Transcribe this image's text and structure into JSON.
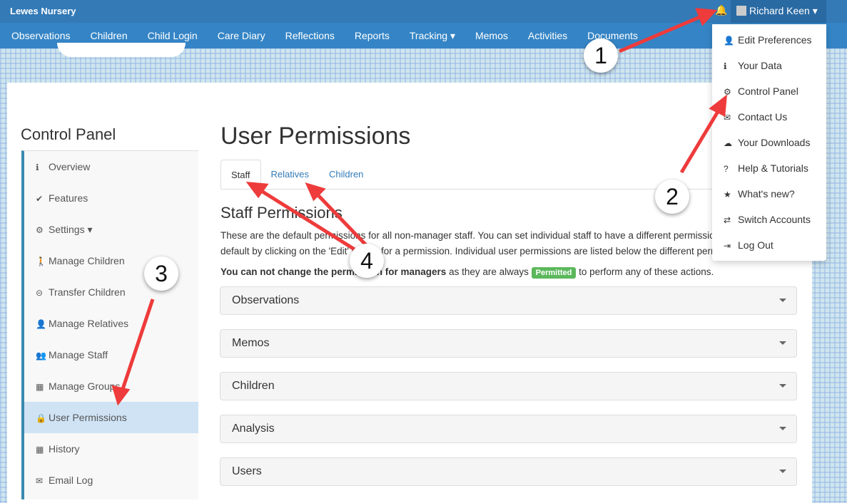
{
  "header": {
    "brand": "Lewes Nursery",
    "user": "Richard Keen"
  },
  "nav": [
    "Observations",
    "Children",
    "Child Login",
    "Care Diary",
    "Reflections",
    "Reports",
    "Tracking ▾",
    "Memos",
    "Activities",
    "Documents"
  ],
  "user_menu": [
    {
      "icon": "user-icon",
      "glyph": "👤",
      "label": "Edit Preferences"
    },
    {
      "icon": "info-icon",
      "glyph": "ℹ",
      "label": "Your Data"
    },
    {
      "icon": "gear-icon",
      "glyph": "⚙",
      "label": "Control Panel"
    },
    {
      "icon": "envelope-icon",
      "glyph": "✉",
      "label": "Contact Us"
    },
    {
      "icon": "cloud-download-icon",
      "glyph": "☁",
      "label": "Your Downloads"
    },
    {
      "icon": "question-icon",
      "glyph": "?",
      "label": "Help & Tutorials"
    },
    {
      "icon": "star-icon",
      "glyph": "★",
      "label": "What's new?"
    },
    {
      "icon": "switch-icon",
      "glyph": "⇄",
      "label": "Switch Accounts"
    },
    {
      "icon": "logout-icon",
      "glyph": "⇥",
      "label": "Log Out"
    }
  ],
  "sidebar": {
    "title": "Control Panel",
    "items": [
      {
        "icon": "info-icon",
        "glyph": "ℹ",
        "label": "Overview"
      },
      {
        "icon": "check-icon",
        "glyph": "✔",
        "label": "Features"
      },
      {
        "icon": "gear-icon",
        "glyph": "⚙",
        "label": "Settings ▾"
      },
      {
        "icon": "child-icon",
        "glyph": "🚶",
        "label": "Manage Children"
      },
      {
        "icon": "transfer-icon",
        "glyph": "⊝",
        "label": "Transfer Children"
      },
      {
        "icon": "user-icon",
        "glyph": "👤",
        "label": "Manage Relatives"
      },
      {
        "icon": "users-icon",
        "glyph": "👥",
        "label": "Manage Staff"
      },
      {
        "icon": "grid-icon",
        "glyph": "▦",
        "label": "Manage Groups"
      },
      {
        "icon": "lock-icon",
        "glyph": "🔒",
        "label": "User Permissions"
      },
      {
        "icon": "calendar-icon",
        "glyph": "▦",
        "label": "History"
      },
      {
        "icon": "envelope-icon",
        "glyph": "✉",
        "label": "Email Log"
      }
    ]
  },
  "page": {
    "title": "User Permissions",
    "tabs": [
      "Staff",
      "Relatives",
      "Children"
    ],
    "section": "Staff Permissions",
    "para1": "These are the default permissions for all non-manager staff. You can set individual staff to have a different permission to the",
    "para2": "default by clicking on the 'Edit' button for a permission. Individual user permissions are listed below the different permissions.",
    "note_bold": "You can not change the permission for managers",
    "note_mid": " as they are always ",
    "badge": "Permitted",
    "note_end": " to perform any of these actions.",
    "accordions": [
      "Observations",
      "Memos",
      "Children",
      "Analysis",
      "Users"
    ]
  },
  "callouts": [
    "1",
    "2",
    "3",
    "4"
  ]
}
